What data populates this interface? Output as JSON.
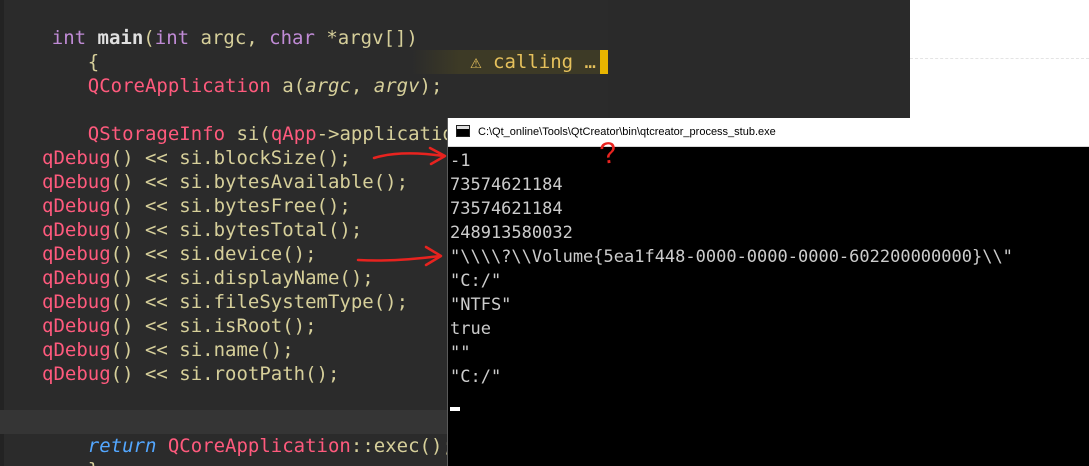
{
  "editor": {
    "line0": {
      "t1": "int ",
      "t2": "main",
      "t3": "(",
      "t4": "int ",
      "t5": "argc, ",
      "t6": "char ",
      "t7": "*argv[])"
    },
    "line1": {
      "t1": "{"
    },
    "line2": {
      "t1": "QCoreApplication ",
      "t2": "a(",
      "t3": "argc",
      "t4": ", ",
      "t5": "argv",
      "t6": ");"
    },
    "warning_text": "⚠ calling …",
    "line4": {
      "t1": "QStorageInfo ",
      "t2": "si(",
      "t3": "qApp",
      "t4": "->applicationDirPath());"
    },
    "calls": [
      {
        "fn": "qDebug",
        "rest": "() << si.blockSize();"
      },
      {
        "fn": "qDebug",
        "rest": "() << si.bytesAvailable();"
      },
      {
        "fn": "qDebug",
        "rest": "() << si.bytesFree();"
      },
      {
        "fn": "qDebug",
        "rest": "() << si.bytesTotal();"
      },
      {
        "fn": "qDebug",
        "rest": "() << si.device();"
      },
      {
        "fn": "qDebug",
        "rest": "() << si.displayName();"
      },
      {
        "fn": "qDebug",
        "rest": "() << si.fileSystemType();"
      },
      {
        "fn": "qDebug",
        "rest": "() << si.isRoot();"
      },
      {
        "fn": "qDebug",
        "rest": "() << si.name();"
      },
      {
        "fn": "qDebug",
        "rest": "() << si.rootPath();"
      }
    ],
    "line17": {
      "t1": "return ",
      "t2": "QCoreApplication",
      "t3": "::exec();"
    },
    "line18": {
      "t1": "}"
    }
  },
  "console": {
    "title": "C:\\Qt_online\\Tools\\QtCreator\\bin\\qtcreator_process_stub.exe",
    "output": [
      "-1",
      "73574621184",
      "73574621184",
      "248913580032",
      "\"\\\\\\\\?\\\\Volume{5ea1f448-0000-0000-0000-602200000000}\\\\\"",
      "\"C:/\"",
      "\"NTFS\"",
      "true",
      "\"\"",
      "\"C:/\""
    ]
  },
  "annotation": {
    "question_mark": "?"
  },
  "colors": {
    "editor_bg": "#2b2b2b",
    "keyword": "#c08bd6",
    "class_name": "#ff5a7d",
    "plain_text": "#d6cf9a",
    "return_keyword": "#53a7ff",
    "warning": "#e6c15c",
    "annotation_red": "#e8231f",
    "console_bg": "#000000",
    "console_text": "#cccccc"
  },
  "icons": {
    "console_window": "console-window-icon",
    "warning": "warning-triangle-icon",
    "arrow": "red-hand-drawn-arrow"
  }
}
